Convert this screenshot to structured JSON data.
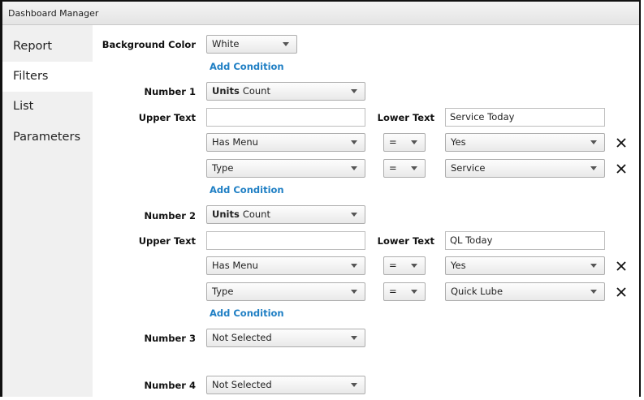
{
  "window": {
    "title": "Dashboard Manager"
  },
  "sidebar": {
    "items": [
      {
        "label": "Report"
      },
      {
        "label": "Filters"
      },
      {
        "label": "List"
      },
      {
        "label": "Parameters"
      }
    ]
  },
  "form": {
    "background_color": {
      "label": "Background Color",
      "value": "White"
    },
    "add_condition": "Add Condition",
    "number1": {
      "label": "Number 1",
      "units_prefix": "Units",
      "units_value": "Count",
      "upper_label": "Upper Text",
      "upper_value": "",
      "lower_label": "Lower Text",
      "lower_value": "Service Today",
      "conditions": [
        {
          "field": "Has Menu",
          "op": "=",
          "value": "Yes"
        },
        {
          "field": "Type",
          "op": "=",
          "value": "Service"
        }
      ]
    },
    "number2": {
      "label": "Number 2",
      "units_prefix": "Units",
      "units_value": "Count",
      "upper_label": "Upper Text",
      "upper_value": "",
      "lower_label": "Lower Text",
      "lower_value": "QL Today",
      "conditions": [
        {
          "field": "Has Menu",
          "op": "=",
          "value": "Yes"
        },
        {
          "field": "Type",
          "op": "=",
          "value": "Quick Lube"
        }
      ]
    },
    "number3": {
      "label": "Number 3",
      "value": "Not Selected"
    },
    "number4": {
      "label": "Number 4",
      "value": "Not Selected"
    }
  }
}
